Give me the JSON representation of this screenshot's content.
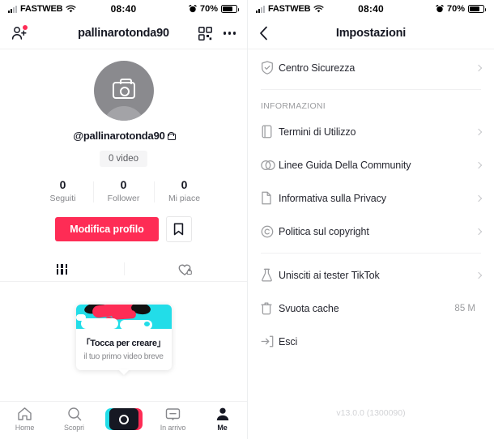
{
  "status_bar": {
    "carrier": "FASTWEB",
    "time": "08:40",
    "battery_pct": "70%",
    "wifi_icon": "wifi-icon",
    "signal_icon": "signal-bars-icon",
    "battery_icon": "battery-icon",
    "alarm_icon": "alarm-icon"
  },
  "profile_panel": {
    "header": {
      "add_friend_icon": "add-friend-icon",
      "username": "pallinarotonda90",
      "qr_icon": "qr-code-icon",
      "more_icon": "more-options-icon",
      "has_notification_dot": true
    },
    "avatar_icon": "camera-avatar-placeholder",
    "handle": "@pallinarotonda90",
    "private_lock_icon": "lock-icon",
    "videos_pill": "0 video",
    "stats": [
      {
        "value": "0",
        "label": "Seguiti"
      },
      {
        "value": "0",
        "label": "Follower"
      },
      {
        "value": "0",
        "label": "Mi piace"
      }
    ],
    "edit_button": "Modifica profilo",
    "bookmark_icon": "bookmark-icon",
    "tabs": [
      {
        "name": "videos-grid-tab",
        "icon": "grid-icon"
      },
      {
        "name": "liked-private-tab",
        "icon": "heart-lock-icon"
      }
    ],
    "create_card": {
      "title": "「Tocca per creare」",
      "subtitle": "il tuo primo video breve"
    },
    "bottom_nav": [
      {
        "label": "Home",
        "icon": "home-icon",
        "active": false
      },
      {
        "label": "Scopri",
        "icon": "search-icon",
        "active": false
      },
      {
        "label": "",
        "icon": "create-camera-icon",
        "active": false
      },
      {
        "label": "In arrivo",
        "icon": "inbox-icon",
        "active": false
      },
      {
        "label": "Me",
        "icon": "profile-person-icon",
        "active": true
      }
    ]
  },
  "settings_panel": {
    "header": {
      "back_icon": "back-chevron-icon",
      "title": "Impostazioni"
    },
    "top_group": [
      {
        "label": "Centro Sicurezza",
        "icon": "shield-check-icon",
        "chevron": true
      }
    ],
    "section_title": "INFORMAZIONI",
    "info_group": [
      {
        "label": "Termini di Utilizzo",
        "icon": "book-icon",
        "chevron": true
      },
      {
        "label": "Linee Guida Della Community",
        "icon": "community-circles-icon",
        "chevron": true
      },
      {
        "label": "Informativa sulla Privacy",
        "icon": "document-icon",
        "chevron": true
      },
      {
        "label": "Politica sul copyright",
        "icon": "copyright-icon",
        "chevron": true
      }
    ],
    "bottom_group": [
      {
        "label": "Unisciti ai tester TikTok",
        "icon": "flask-icon",
        "chevron": true
      },
      {
        "label": "Svuota cache",
        "icon": "trash-icon",
        "value": "85 M",
        "chevron": false
      },
      {
        "label": "Esci",
        "icon": "logout-icon",
        "chevron": false
      }
    ],
    "version": "v13.0.0 (1300090)"
  },
  "colors": {
    "accent_red": "#FE2C55",
    "accent_cyan": "#22DDE8",
    "text_primary": "#161823",
    "text_muted": "#86878B",
    "divider": "#F0F0F1"
  }
}
